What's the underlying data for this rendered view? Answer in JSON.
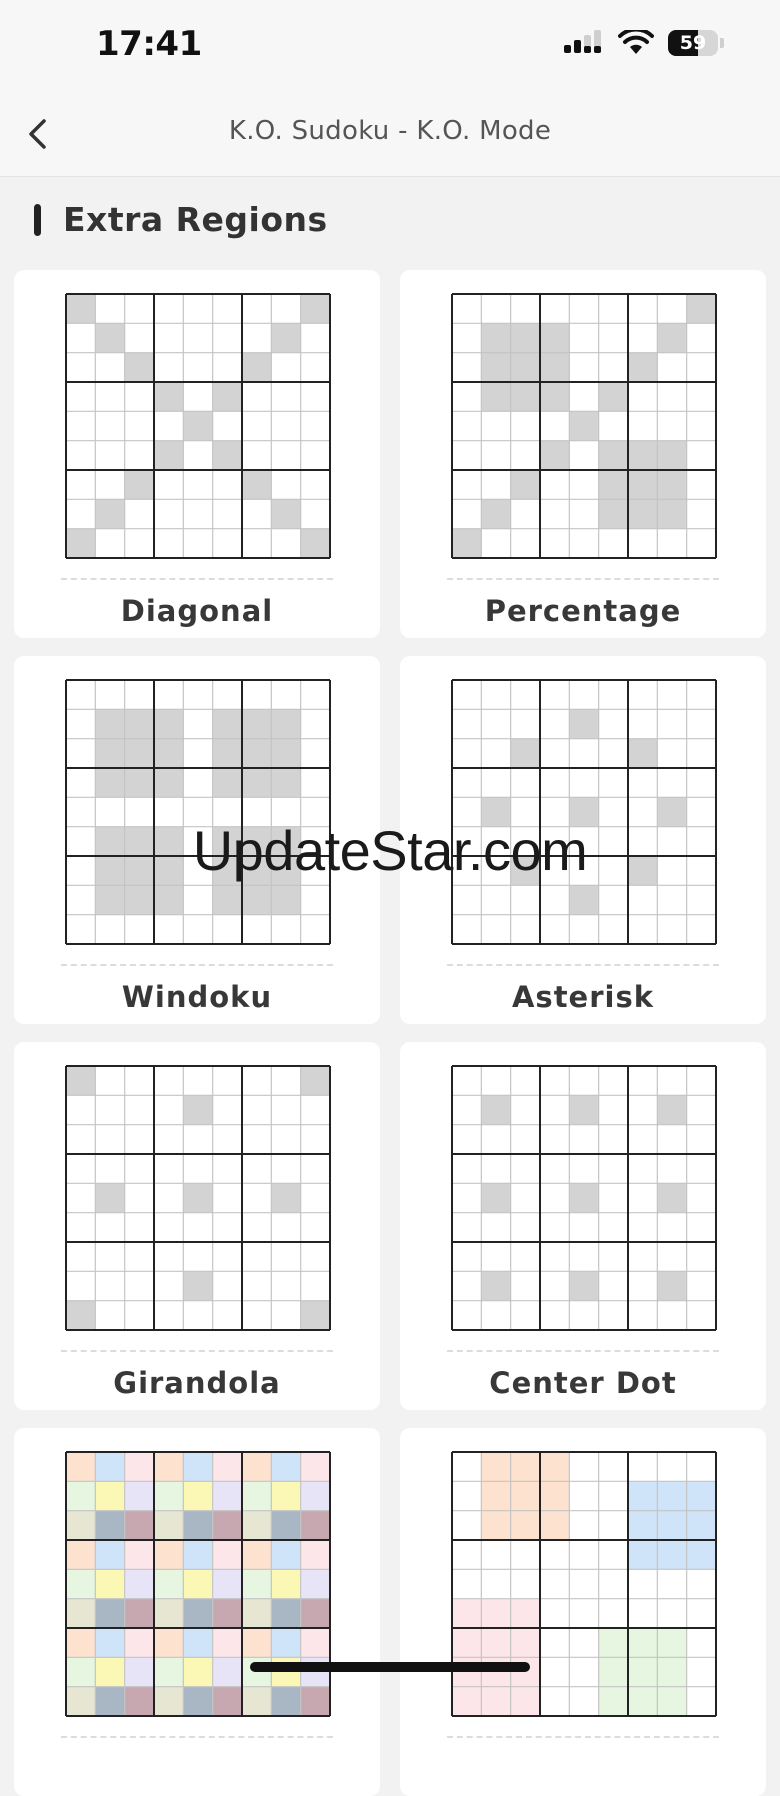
{
  "status": {
    "time": "17:41",
    "battery": "59",
    "battery_level": 0.59,
    "icons": [
      "cellular-icon",
      "wifi-icon",
      "battery-icon"
    ]
  },
  "nav": {
    "title": "K.O. Sudoku - K.O. Mode",
    "back_icon": "chevron-left-icon"
  },
  "section": {
    "title": "Extra Regions"
  },
  "colors": {
    "cell_highlight": "#d3d3d3",
    "grid_thin": "#c4c4c4",
    "grid_thick": "#222222",
    "card_bg": "#ffffff",
    "page_bg": "#f2f2f2"
  },
  "cards": [
    {
      "label": "Diagonal",
      "cells": [
        [
          0,
          0
        ],
        [
          1,
          1
        ],
        [
          2,
          2
        ],
        [
          3,
          3
        ],
        [
          4,
          4
        ],
        [
          5,
          5
        ],
        [
          6,
          6
        ],
        [
          7,
          7
        ],
        [
          8,
          8
        ],
        [
          0,
          8
        ],
        [
          1,
          7
        ],
        [
          2,
          6
        ],
        [
          3,
          5
        ],
        [
          5,
          3
        ],
        [
          6,
          2
        ],
        [
          7,
          1
        ],
        [
          8,
          0
        ]
      ]
    },
    {
      "label": "Percentage",
      "cells": [
        [
          1,
          1
        ],
        [
          1,
          2
        ],
        [
          1,
          3
        ],
        [
          2,
          1
        ],
        [
          2,
          2
        ],
        [
          2,
          3
        ],
        [
          3,
          1
        ],
        [
          3,
          2
        ],
        [
          3,
          3
        ],
        [
          0,
          8
        ],
        [
          1,
          7
        ],
        [
          2,
          6
        ],
        [
          3,
          5
        ],
        [
          4,
          4
        ],
        [
          5,
          3
        ],
        [
          6,
          2
        ],
        [
          7,
          1
        ],
        [
          8,
          0
        ],
        [
          5,
          5
        ],
        [
          5,
          6
        ],
        [
          5,
          7
        ],
        [
          6,
          5
        ],
        [
          6,
          6
        ],
        [
          6,
          7
        ],
        [
          7,
          5
        ],
        [
          7,
          6
        ],
        [
          7,
          7
        ]
      ]
    },
    {
      "label": "Windoku",
      "cells": [
        [
          1,
          1
        ],
        [
          1,
          2
        ],
        [
          1,
          3
        ],
        [
          2,
          1
        ],
        [
          2,
          2
        ],
        [
          2,
          3
        ],
        [
          3,
          1
        ],
        [
          3,
          2
        ],
        [
          3,
          3
        ],
        [
          1,
          5
        ],
        [
          1,
          6
        ],
        [
          1,
          7
        ],
        [
          2,
          5
        ],
        [
          2,
          6
        ],
        [
          2,
          7
        ],
        [
          3,
          5
        ],
        [
          3,
          6
        ],
        [
          3,
          7
        ],
        [
          5,
          1
        ],
        [
          5,
          2
        ],
        [
          5,
          3
        ],
        [
          6,
          1
        ],
        [
          6,
          2
        ],
        [
          6,
          3
        ],
        [
          7,
          1
        ],
        [
          7,
          2
        ],
        [
          7,
          3
        ],
        [
          5,
          5
        ],
        [
          5,
          6
        ],
        [
          5,
          7
        ],
        [
          6,
          5
        ],
        [
          6,
          6
        ],
        [
          6,
          7
        ],
        [
          7,
          5
        ],
        [
          7,
          6
        ],
        [
          7,
          7
        ]
      ]
    },
    {
      "label": "Asterisk",
      "cells": [
        [
          1,
          4
        ],
        [
          2,
          2
        ],
        [
          2,
          6
        ],
        [
          4,
          1
        ],
        [
          4,
          4
        ],
        [
          4,
          7
        ],
        [
          6,
          2
        ],
        [
          6,
          6
        ],
        [
          7,
          4
        ]
      ]
    },
    {
      "label": "Girandola",
      "cells": [
        [
          0,
          0
        ],
        [
          0,
          8
        ],
        [
          1,
          4
        ],
        [
          4,
          1
        ],
        [
          4,
          4
        ],
        [
          4,
          7
        ],
        [
          7,
          4
        ],
        [
          8,
          0
        ],
        [
          8,
          8
        ]
      ]
    },
    {
      "label": "Center Dot",
      "cells": [
        [
          1,
          1
        ],
        [
          1,
          4
        ],
        [
          1,
          7
        ],
        [
          4,
          1
        ],
        [
          4,
          4
        ],
        [
          4,
          7
        ],
        [
          7,
          1
        ],
        [
          7,
          4
        ],
        [
          7,
          7
        ]
      ]
    },
    {
      "label": "",
      "color_pattern": [
        [
          "#fde3cf",
          "#cfe3f9",
          "#fde6ea"
        ],
        [
          "#e6f6e0",
          "#fbf7b4",
          "#e8e4f8"
        ],
        [
          "#e7e6d2",
          "#a9b7c4",
          "#c7a8b0"
        ]
      ]
    },
    {
      "label": "",
      "color_blocks": [
        {
          "r0": 0,
          "c0": 1,
          "r1": 2,
          "c1": 3,
          "color": "#fde3cf"
        },
        {
          "r0": 1,
          "c0": 6,
          "r1": 3,
          "c1": 8,
          "color": "#cfe3f9"
        },
        {
          "r0": 5,
          "c0": 0,
          "r1": 8,
          "c1": 2,
          "color": "#fde6ea"
        },
        {
          "r0": 6,
          "c0": 5,
          "r1": 8,
          "c1": 7,
          "color": "#e6f6e0"
        }
      ]
    }
  ],
  "watermark": "UpdateStar.com"
}
